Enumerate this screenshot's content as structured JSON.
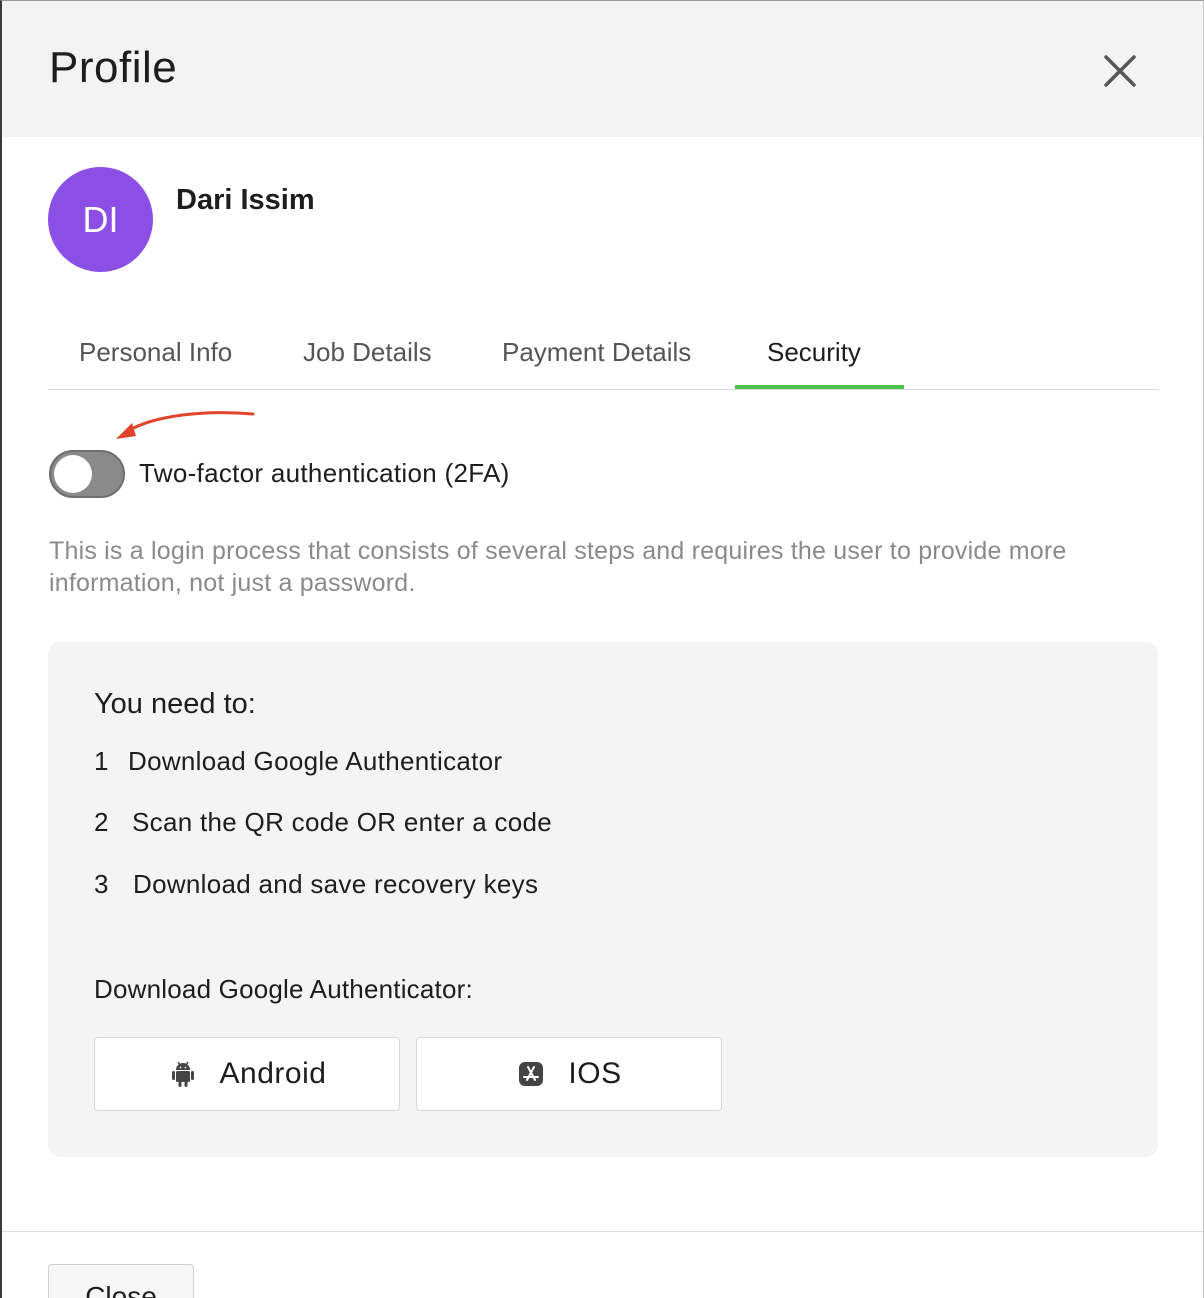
{
  "header": {
    "title": "Profile"
  },
  "user": {
    "initials": "DI",
    "name": "Dari Issim"
  },
  "tabs": [
    {
      "label": "Personal Info",
      "active": false
    },
    {
      "label": "Job Details",
      "active": false
    },
    {
      "label": "Payment Details",
      "active": false
    },
    {
      "label": "Security",
      "active": true
    }
  ],
  "security": {
    "twofa_label": "Two-factor authentication (2FA)",
    "twofa_enabled": false,
    "description": "This is a login process that consists of several steps and requires the user to provide more information, not just a password.",
    "panel": {
      "title": "You need to:",
      "steps": [
        {
          "num": "1",
          "text": "Download Google Authenticator"
        },
        {
          "num": "2",
          "text": "Scan the QR code OR enter a code"
        },
        {
          "num": "3",
          "text": "Download and save recovery keys"
        }
      ],
      "download_label": "Download Google Authenticator:",
      "buttons": [
        {
          "label": "Android",
          "icon": "android-icon"
        },
        {
          "label": "IOS",
          "icon": "app-store-icon"
        }
      ]
    }
  },
  "footer": {
    "close_label": "Close"
  },
  "colors": {
    "avatar": "#8b4fe6",
    "active_tab": "#4cc34f",
    "annotation_arrow": "#e0452c",
    "toggle_off": "#8a8a8a"
  }
}
